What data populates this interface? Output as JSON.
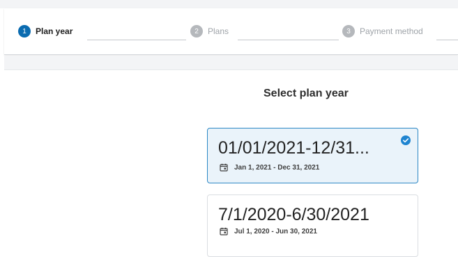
{
  "stepper": {
    "steps": [
      {
        "number": "1",
        "label": "Plan year",
        "state": "active"
      },
      {
        "number": "2",
        "label": "Plans",
        "state": "inactive"
      },
      {
        "number": "3",
        "label": "Payment method",
        "state": "inactive"
      }
    ]
  },
  "main": {
    "title": "Select plan year",
    "plan_years": [
      {
        "name": "01/01/2021-12/31...",
        "dates": "Jan 1, 2021 - Dec 31, 2021",
        "selected": true,
        "icon": "calendar-icon"
      },
      {
        "name": "7/1/2020-6/30/2021",
        "dates": "Jul 1, 2020 - Jun 30, 2021",
        "selected": false,
        "icon": "calendar-icon"
      }
    ]
  },
  "colors": {
    "accent": "#0a6bb0",
    "selected_bg": "#eaf3fa",
    "selected_border": "#2a86c4",
    "check": "#1f84d0",
    "inactive_step": "#b5b8bc"
  }
}
